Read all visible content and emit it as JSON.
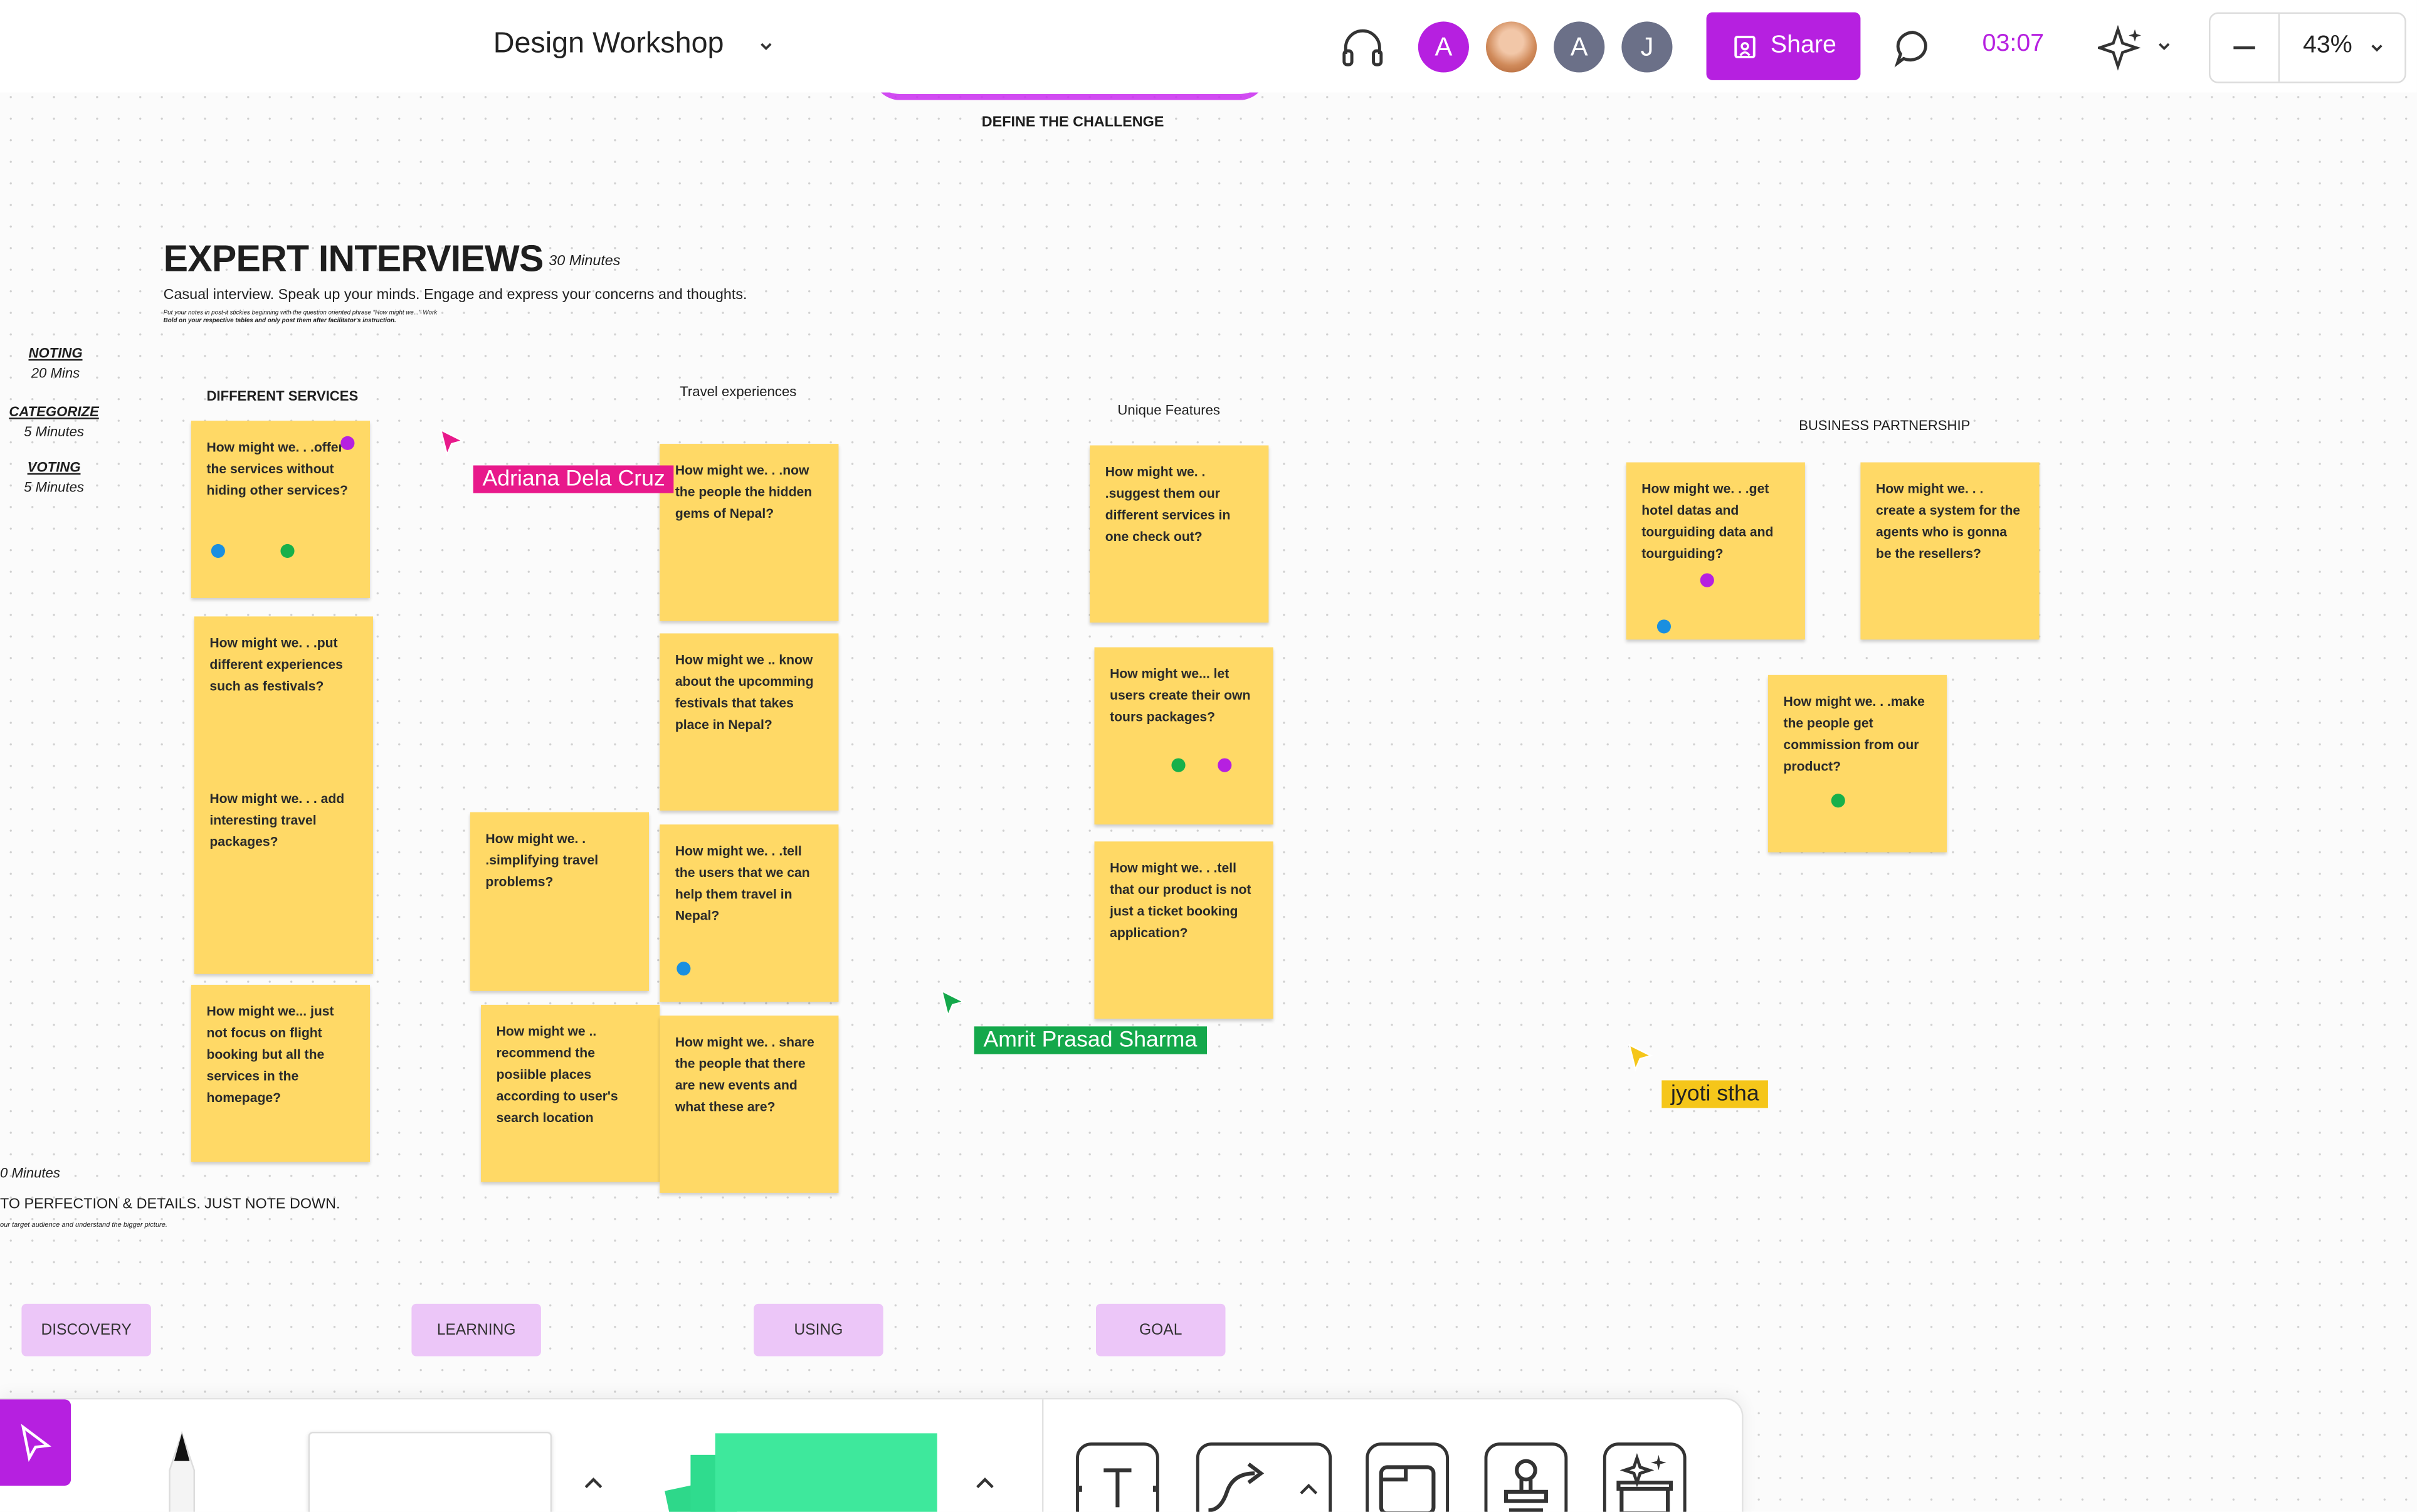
{
  "board_title": "Design Workshop",
  "timer": "03:07",
  "zoom": "43%",
  "share_label": "Share",
  "avatars": [
    "A",
    "A",
    "J"
  ],
  "colors": {
    "accent": "#b620e0",
    "sticky": "#ffd966",
    "tag": "#ecc6f8"
  },
  "define_challenge": "DEFINE THE CHALLENGE",
  "section": {
    "title": "EXPERT INTERVIEWS",
    "duration": "30 Minutes",
    "subtitle": "Casual interview. Speak up your minds. Engage and express your concerns and thoughts.",
    "fine_print_1": "Put your notes in post-it stickies beginning with the question oriented phrase \"How might we...\" Work",
    "fine_print_2": "Bold on your respective tables and only post them after facilitator's instruction."
  },
  "side_meta": [
    {
      "h": "NOTING",
      "v": "20 Mins"
    },
    {
      "h": "CATEGORIZE",
      "v": "5 Minutes"
    },
    {
      "h": "VOTING",
      "v": "5 Minutes"
    }
  ],
  "left_notes": {
    "minutes": "0 Minutes",
    "line": "TO PERFECTION & DETAILS. JUST NOTE DOWN.",
    "small": "our target audience and understand the bigger picture."
  },
  "columns": {
    "services": "DIFFERENT SERVICES",
    "travel": "Travel experiences",
    "features": "Unique Features",
    "partnership": "BUSINESS PARTNERSHIP"
  },
  "stickies": {
    "s1": "How might we. . .offer the services without hiding other services?",
    "s2": "How might we. . .put different experiences such as festivals?",
    "s3": "How might we. . . add interesting travel packages?",
    "s4": "How might we... just not focus on flight booking but all the services in the homepage?",
    "s5": "How might we. . .simplifying travel problems?",
    "s6": "How might we .. recommend the posiible places according to user's search location",
    "t1": "How might we. . .now the people the hidden gems of Nepal?",
    "t2": "How might we .. know about the upcomming festivals that takes place in Nepal?",
    "t3": "How might we. . .tell the users that we can help them travel in Nepal?",
    "t4": "How might we. . share the people that there are new events and what these are?",
    "f1": "How might we. . .suggest them our different services in one check out?",
    "f2": "How might we... let users create their own tours packages?",
    "f3": "How might we. . .tell that our product is not just a ticket booking application?",
    "b1": "How might we. . .get hotel datas and tourguiding data and tourguiding?",
    "b2": "How might we. . . create a system for the agents who is gonna be the resellers?",
    "b3": "How might we. . .make the people get commission from our product?"
  },
  "cursors": {
    "adriana": "Adriana Dela Cruz",
    "amrit": "Amrit Prasad Sharma",
    "jyoti": "jyoti stha"
  },
  "tags": [
    "DISCOVERY",
    "LEARNING",
    "USING",
    "GOAL"
  ]
}
